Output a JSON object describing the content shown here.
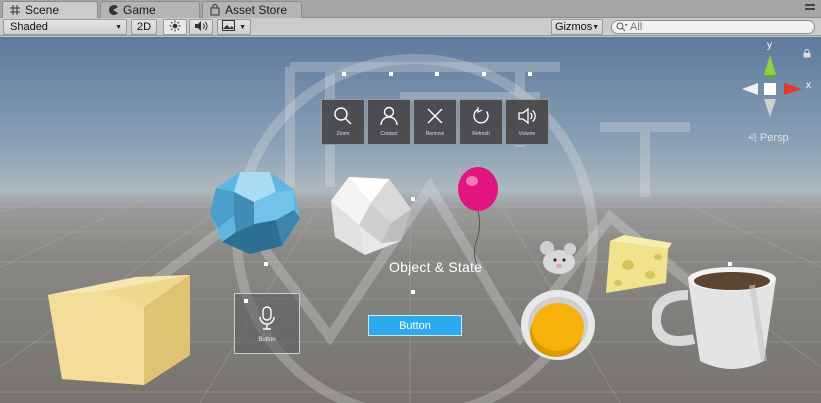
{
  "tabs": [
    {
      "label": "Scene",
      "icon": "grid-icon",
      "active": true
    },
    {
      "label": "Game",
      "icon": "pacman-icon",
      "active": false
    },
    {
      "label": "Asset Store",
      "icon": "store-bag-icon",
      "active": false
    }
  ],
  "toolbar": {
    "shading_mode": "Shaded",
    "mode_2d": "2D",
    "gizmos_label": "Gizmos",
    "search_placeholder": "All"
  },
  "scene": {
    "title": "Object & State",
    "button_label": "Button",
    "mic_tile_label": "Button",
    "app_bar": [
      {
        "label": "Zoom",
        "icon": "magnifier-icon"
      },
      {
        "label": "Contact",
        "icon": "person-icon"
      },
      {
        "label": "Remove",
        "icon": "close-icon"
      },
      {
        "label": "Refresh",
        "icon": "refresh-icon"
      },
      {
        "label": "Volume",
        "icon": "speaker-icon"
      }
    ],
    "gizmo": {
      "projection_label": "Persp",
      "axis_y": "y",
      "axis_x": "x"
    }
  },
  "colors": {
    "holo_button": "#2da9ef",
    "balloon": "#e0157f",
    "icosahedron": "#5fb6e1",
    "gizmo_y": "#8fd13c",
    "gizmo_x": "#e23a2a"
  }
}
